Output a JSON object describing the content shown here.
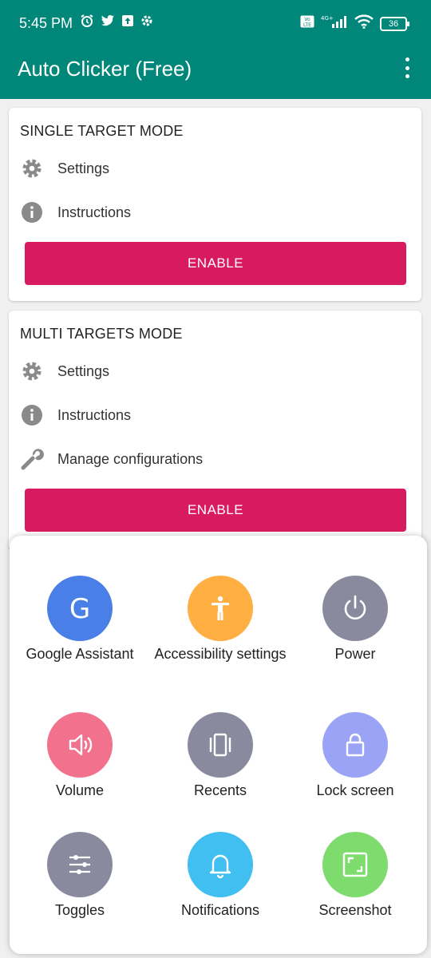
{
  "status_bar": {
    "time": "5:45 PM",
    "battery": "36",
    "icons": [
      "alarm-icon",
      "twitter-icon",
      "upload-icon",
      "settings-icon",
      "volte-icon",
      "signal-4g-icon",
      "wifi-icon",
      "battery-icon"
    ]
  },
  "app_bar": {
    "title": "Auto Clicker (Free)"
  },
  "single_mode": {
    "title": "SINGLE TARGET MODE",
    "settings": "Settings",
    "instructions": "Instructions",
    "enable": "ENABLE"
  },
  "multi_mode": {
    "title": "MULTI TARGETS MODE",
    "settings": "Settings",
    "instructions": "Instructions",
    "manage": "Manage configurations",
    "enable": "ENABLE"
  },
  "menu": {
    "items": [
      {
        "label": "Google Assistant",
        "color": "#4a7fe8"
      },
      {
        "label": "Accessibility settings",
        "color": "#ffae42"
      },
      {
        "label": "Power",
        "color": "#8a8a9e"
      },
      {
        "label": "Volume",
        "color": "#f2728d"
      },
      {
        "label": "Recents",
        "color": "#8a8a9e"
      },
      {
        "label": "Lock screen",
        "color": "#9aa3f5"
      },
      {
        "label": "Toggles",
        "color": "#8a8a9e"
      },
      {
        "label": "Notifications",
        "color": "#40bff0"
      },
      {
        "label": "Screenshot",
        "color": "#7ddc6d"
      }
    ]
  },
  "colors": {
    "primary": "#00877a",
    "accent": "#d81b60",
    "icon_grey": "#8a8a8a"
  }
}
